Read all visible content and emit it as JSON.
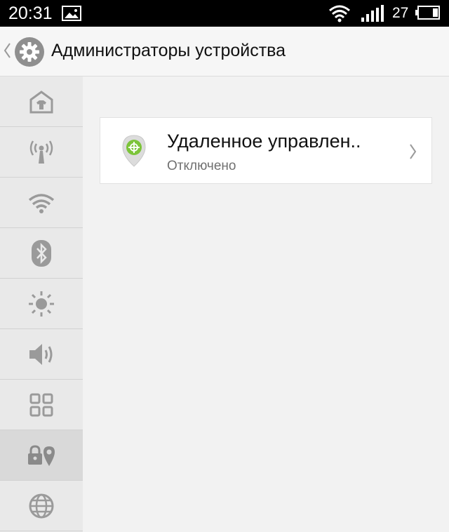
{
  "status_bar": {
    "time": "20:31",
    "battery_level": "27"
  },
  "header": {
    "title": "Администраторы устройства"
  },
  "sidebar": {
    "items": [
      {
        "icon": "home-icon",
        "active": false
      },
      {
        "icon": "hotspot-icon",
        "active": false
      },
      {
        "icon": "wifi-icon",
        "active": false
      },
      {
        "icon": "bluetooth-icon",
        "active": false
      },
      {
        "icon": "brightness-icon",
        "active": false
      },
      {
        "icon": "volume-icon",
        "active": false
      },
      {
        "icon": "apps-grid-icon",
        "active": false
      },
      {
        "icon": "lock-location-icon",
        "active": true
      },
      {
        "icon": "globe-icon",
        "active": false
      }
    ]
  },
  "device_admins": [
    {
      "name": "Удаленное управлен..",
      "status": "Отключено",
      "icon": "remote-control-app-icon"
    }
  ],
  "colors": {
    "accent_green": "#7cc43a",
    "background": "#f2f2f2",
    "sidebar_background": "#e9e9e9",
    "icon_gray": "#9a9a9a"
  }
}
